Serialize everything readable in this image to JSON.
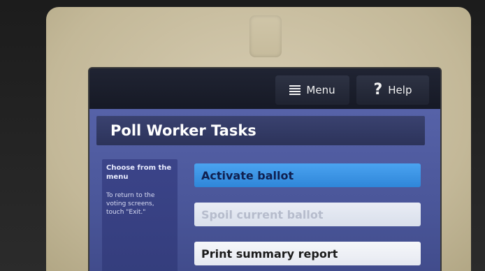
{
  "header": {
    "menu_label": "Menu",
    "menu_icon": "hamburger-icon",
    "help_label": "Help",
    "help_icon": "question-mark-icon"
  },
  "page": {
    "title": "Poll Worker Tasks"
  },
  "sidebar": {
    "heading": "Choose from the menu",
    "note": "To return to the voting screens, touch \"Exit.\""
  },
  "tasks": [
    {
      "label": "Activate ballot",
      "state": "highlighted"
    },
    {
      "label": "Spoil current ballot",
      "state": "disabled"
    },
    {
      "label": "Print summary report",
      "state": "enabled"
    }
  ],
  "colors": {
    "accent": "#2f86d9",
    "content_bg": "#4a5699",
    "title_bg": "#2c335a"
  }
}
